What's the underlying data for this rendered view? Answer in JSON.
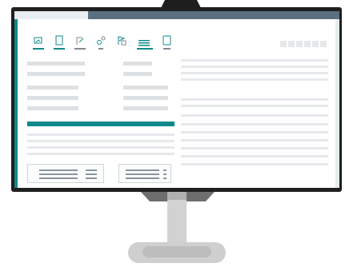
{
  "screen": {
    "toolbar": {
      "icons": [
        "open-image-icon",
        "document-icon",
        "export-icon",
        "settings-icon",
        "flag-icon",
        "list-icon",
        "device-icon"
      ]
    },
    "status_squares": 6,
    "colors": {
      "accent": "#0f8a8a",
      "topbar_dark": "#5b6f7f",
      "placeholder": "#dde1e4"
    }
  }
}
